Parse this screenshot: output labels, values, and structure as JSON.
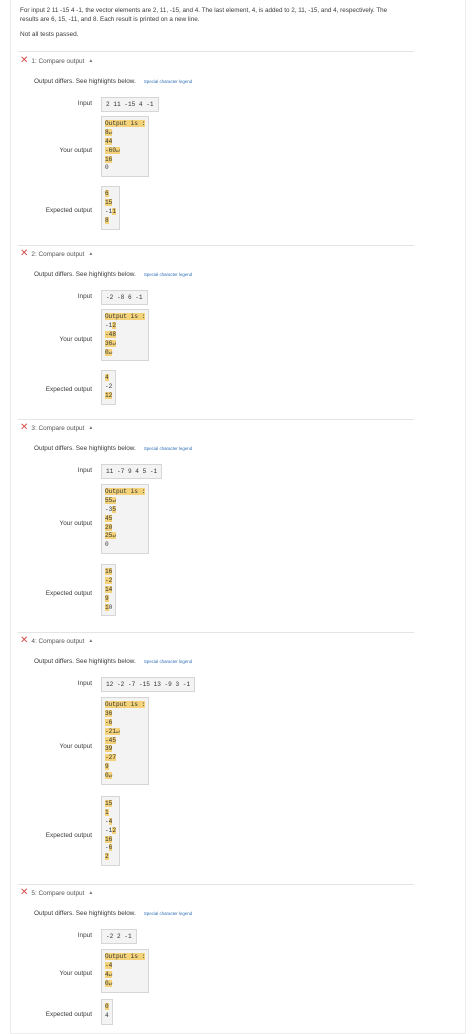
{
  "intro": "For input 2 11 -15 4 -1, the vector elements are 2, 11, -15, and 4. The last element, 4, is added to 2, 11, -15, and 4, respectively. The results are 6, 15, -11, and 8. Each result is printed on a new line.",
  "status": "Not all tests passed.",
  "labels": {
    "output_differs": "Output differs. See highlights below.",
    "legend": "Special character legend",
    "input": "Input",
    "your_output": "Your output",
    "expected_output": "Expected output"
  },
  "colors": {
    "fail": "#d84c4c",
    "highlight": "#f3d27a",
    "link": "#2f6fb6"
  },
  "sections": [
    {
      "title": "1: Compare output",
      "input": "2 11 -15 4 -1",
      "your_output": [
        [
          {
            "t": "Output is :",
            "hl": true
          }
        ],
        [
          {
            "t": "8",
            "hl": true
          },
          {
            "t": "↵",
            "hl": true
          }
        ],
        [
          {
            "t": "44",
            "hl": true
          }
        ],
        [
          {
            "t": "-60",
            "hl": true
          },
          {
            "t": "↵",
            "hl": true
          }
        ],
        [
          {
            "t": "16",
            "hl": true
          }
        ],
        [
          {
            "t": "0",
            "hl": false
          }
        ]
      ],
      "expected_output": [
        [
          {
            "t": "6",
            "hl": true
          }
        ],
        [
          {
            "t": "15",
            "hl": true
          }
        ],
        [
          {
            "t": "-1",
            "hl": false
          },
          {
            "t": "1",
            "hl": true
          }
        ],
        [
          {
            "t": "8",
            "hl": true
          }
        ]
      ]
    },
    {
      "title": "2: Compare output",
      "input": "-2 -8 6 -1",
      "your_output": [
        [
          {
            "t": "Output is :",
            "hl": true
          }
        ],
        [
          {
            "t": "-1",
            "hl": false
          },
          {
            "t": "2",
            "hl": true
          }
        ],
        [
          {
            "t": "-48",
            "hl": true
          }
        ],
        [
          {
            "t": "36",
            "hl": true
          },
          {
            "t": "↵",
            "hl": true
          }
        ],
        [
          {
            "t": "0",
            "hl": true
          },
          {
            "t": "↵",
            "hl": true
          }
        ]
      ],
      "expected_output": [
        [
          {
            "t": "4",
            "hl": true
          }
        ],
        [
          {
            "t": "-2",
            "hl": false
          }
        ],
        [
          {
            "t": "12",
            "hl": true
          }
        ]
      ]
    },
    {
      "title": "3: Compare output",
      "input": "11 -7 9 4 5 -1",
      "your_output": [
        [
          {
            "t": "Output is :",
            "hl": true
          }
        ],
        [
          {
            "t": "55",
            "hl": true
          },
          {
            "t": "↵",
            "hl": true
          }
        ],
        [
          {
            "t": "-3",
            "hl": false
          },
          {
            "t": "5",
            "hl": true
          }
        ],
        [
          {
            "t": "45",
            "hl": true
          }
        ],
        [
          {
            "t": "20",
            "hl": true
          }
        ],
        [
          {
            "t": "25",
            "hl": true
          },
          {
            "t": "↵",
            "hl": true
          }
        ],
        [
          {
            "t": "0",
            "hl": false
          }
        ]
      ],
      "expected_output": [
        [
          {
            "t": "16",
            "hl": true
          }
        ],
        [
          {
            "t": "-2",
            "hl": true
          }
        ],
        [
          {
            "t": "14",
            "hl": true
          }
        ],
        [
          {
            "t": "9",
            "hl": true
          }
        ],
        [
          {
            "t": "1",
            "hl": true
          },
          {
            "t": "0",
            "hl": false
          }
        ]
      ]
    },
    {
      "title": "4: Compare output",
      "input": "12 -2 -7 -15 13 -9 3 -1",
      "your_output": [
        [
          {
            "t": "Output is :",
            "hl": true
          }
        ],
        [
          {
            "t": "36",
            "hl": true
          }
        ],
        [
          {
            "t": "-6",
            "hl": true
          }
        ],
        [
          {
            "t": "-21",
            "hl": true
          },
          {
            "t": "↵",
            "hl": true
          }
        ],
        [
          {
            "t": "-45",
            "hl": true
          }
        ],
        [
          {
            "t": "39",
            "hl": true
          }
        ],
        [
          {
            "t": "-27",
            "hl": true
          }
        ],
        [
          {
            "t": "9",
            "hl": true
          }
        ],
        [
          {
            "t": "0",
            "hl": true
          },
          {
            "t": "↵",
            "hl": true
          }
        ]
      ],
      "expected_output": [
        [
          {
            "t": "15",
            "hl": true
          }
        ],
        [
          {
            "t": "1",
            "hl": true
          }
        ],
        [
          {
            "t": "-",
            "hl": false
          },
          {
            "t": "4",
            "hl": true
          }
        ],
        [
          {
            "t": "-1",
            "hl": false
          },
          {
            "t": "2",
            "hl": true
          }
        ],
        [
          {
            "t": "16",
            "hl": true
          }
        ],
        [
          {
            "t": "-",
            "hl": false
          },
          {
            "t": "6",
            "hl": true
          }
        ],
        [
          {
            "t": "2",
            "hl": true
          }
        ]
      ]
    },
    {
      "title": "5: Compare output",
      "input": "-2 2 -1",
      "your_output": [
        [
          {
            "t": "Output is :",
            "hl": true
          }
        ],
        [
          {
            "t": "-4",
            "hl": true
          }
        ],
        [
          {
            "t": "4",
            "hl": true
          },
          {
            "t": "↵",
            "hl": true
          }
        ],
        [
          {
            "t": "0",
            "hl": true
          },
          {
            "t": "↵",
            "hl": true
          }
        ]
      ],
      "expected_output": [
        [
          {
            "t": "0",
            "hl": true
          }
        ],
        [
          {
            "t": "4",
            "hl": false
          }
        ]
      ]
    }
  ]
}
